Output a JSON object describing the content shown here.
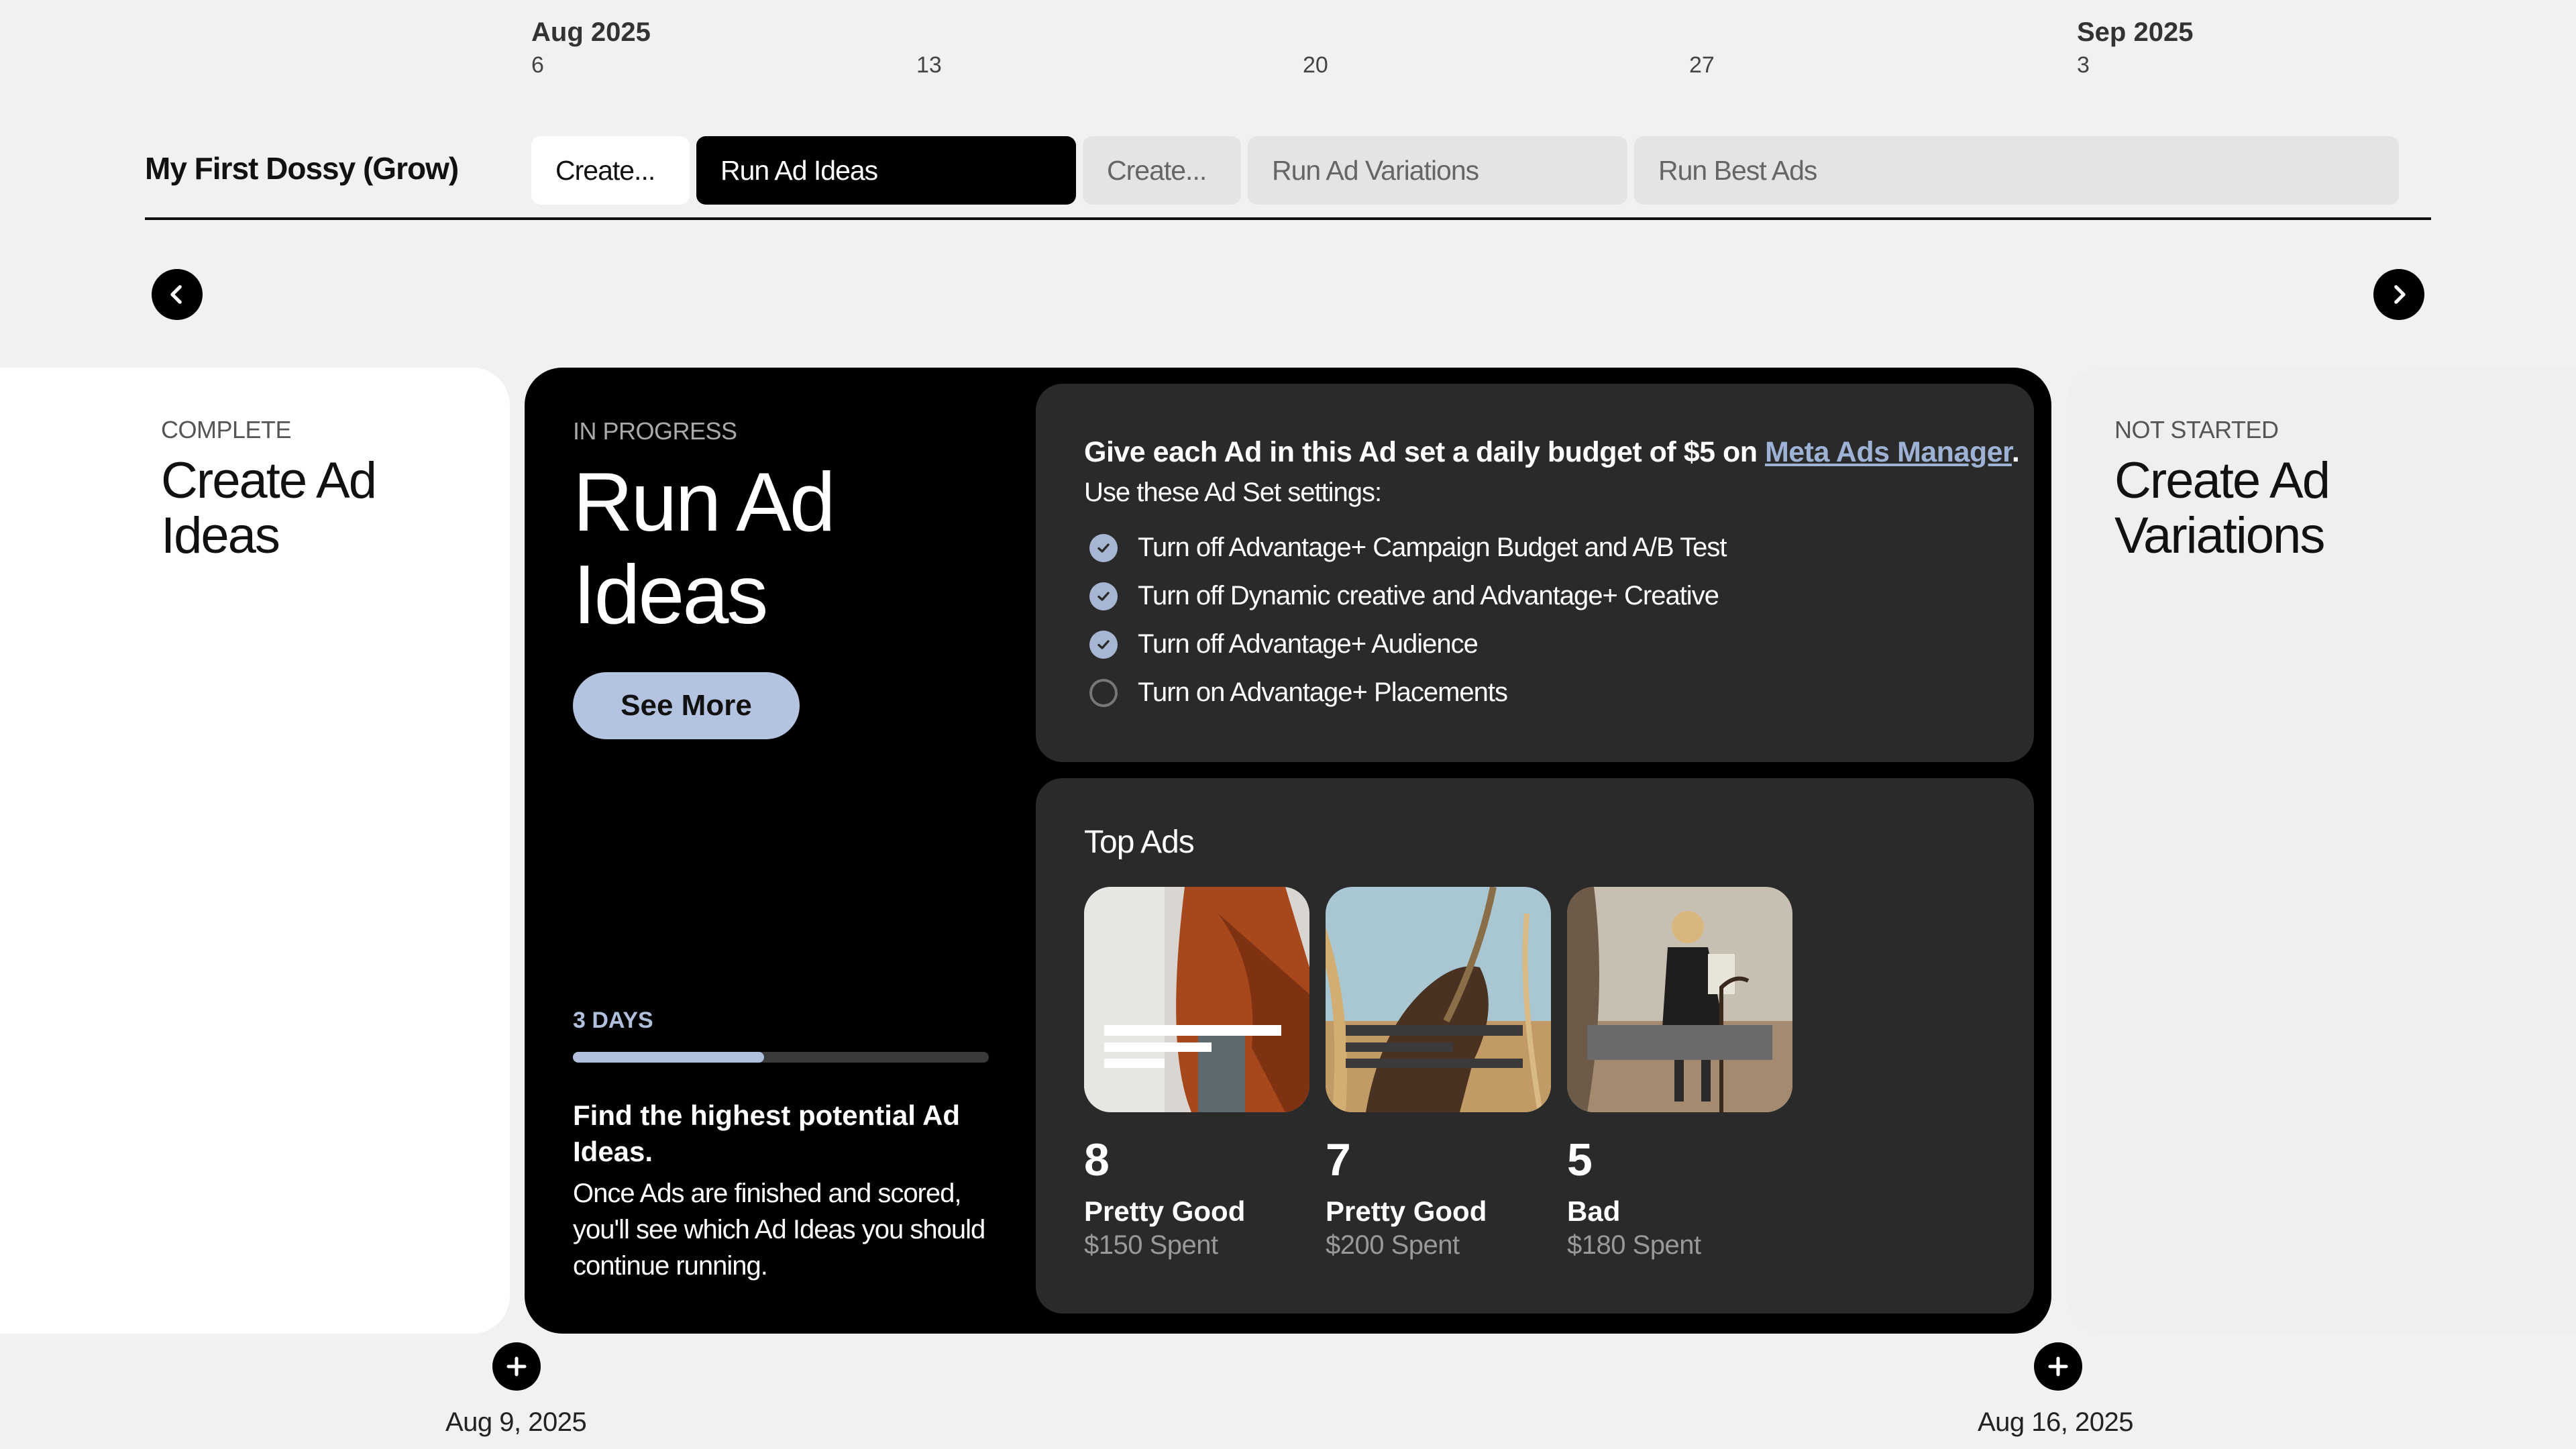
{
  "timeline": {
    "months": [
      {
        "label": "Aug 2025"
      },
      {
        "label": "Sep 2025"
      }
    ],
    "days": [
      "6",
      "13",
      "20",
      "27",
      "3"
    ]
  },
  "project": {
    "title": "My First Dossy (Grow)"
  },
  "phases": [
    {
      "label": "Create...",
      "state": "complete"
    },
    {
      "label": "Run Ad Ideas",
      "state": "active"
    },
    {
      "label": "Create...",
      "state": "not-started"
    },
    {
      "label": "Run Ad Variations",
      "state": "not-started"
    },
    {
      "label": "Run Best Ads",
      "state": "not-started"
    }
  ],
  "nav": {
    "prev_icon": "chevron-left-icon",
    "next_icon": "chevron-right-icon"
  },
  "left_card": {
    "status": "COMPLETE",
    "title_line1": "Create Ad",
    "title_line2": "Ideas"
  },
  "main_card": {
    "status": "IN PROGRESS",
    "title_line1": "Run Ad",
    "title_line2": "Ideas",
    "see_more": "See More",
    "days": "3 DAYS",
    "progress": 0.46,
    "goal_title": "Find the highest potential Ad Ideas.",
    "goal_desc": "Once Ads are finished and scored, you'll see which Ad Ideas you should continue running."
  },
  "settings": {
    "budget_text": "Give each Ad in this Ad set a daily budget of $5 on ",
    "budget_link": "Meta Ads Manager",
    "budget_end": ".",
    "subtitle": "Use these Ad Set settings:",
    "items": [
      {
        "label": "Turn off Advantage+ Campaign Budget and A/B Test",
        "checked": true
      },
      {
        "label": "Turn off Dynamic creative and Advantage+ Creative",
        "checked": true
      },
      {
        "label": "Turn off Advantage+ Audience",
        "checked": true
      },
      {
        "label": "Turn on Advantage+ Placements",
        "checked": false
      }
    ]
  },
  "top_ads": {
    "title": "Top Ads",
    "ads": [
      {
        "score": "8",
        "rating": "Pretty Good",
        "spent": "$150 Spent"
      },
      {
        "score": "7",
        "rating": "Pretty Good",
        "spent": "$200 Spent"
      },
      {
        "score": "5",
        "rating": "Bad",
        "spent": "$180 Spent"
      }
    ]
  },
  "right_card": {
    "status": "NOT STARTED",
    "title_line1": "Create Ad",
    "title_line2": "Variations"
  },
  "milestones": [
    {
      "date": "Aug 9, 2025",
      "icon": "plus-icon"
    },
    {
      "date": "Aug 16, 2025",
      "icon": "plus-icon"
    }
  ],
  "colors": {
    "accent": "#b4c4e0",
    "link": "#9eb2d6",
    "panel": "#2a2a2a",
    "background": "#f2f1f0"
  }
}
